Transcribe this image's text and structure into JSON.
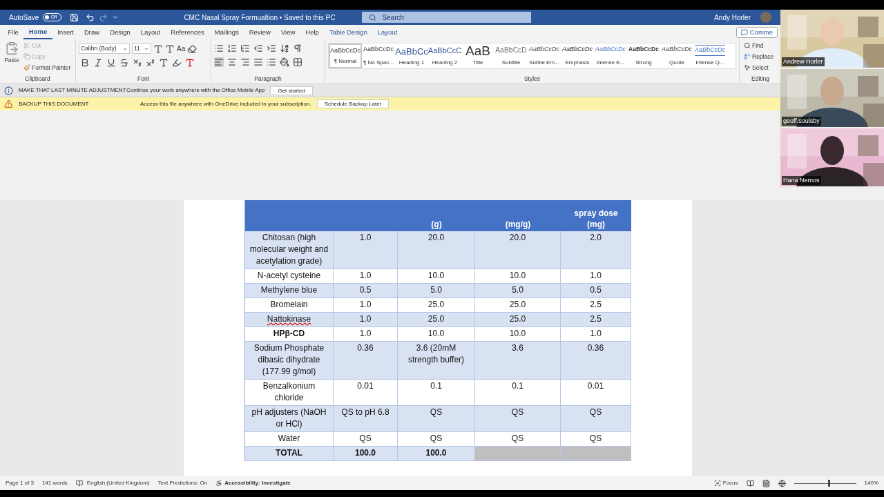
{
  "title_bar": {
    "autosave_label": "AutoSave",
    "autosave": {
      "on": false,
      "label": "Off"
    },
    "title": "CMC Nasal Spray Formualtion • Saved to this PC",
    "search": {
      "placeholder": "Search"
    },
    "user": "Andy Horler"
  },
  "tabs": [
    {
      "label": "File",
      "selected": false,
      "kind": "normal"
    },
    {
      "label": "Home",
      "selected": true,
      "kind": "normal"
    },
    {
      "label": "Insert",
      "selected": false,
      "kind": "normal"
    },
    {
      "label": "Draw",
      "selected": false,
      "kind": "normal"
    },
    {
      "label": "Design",
      "selected": false,
      "kind": "normal"
    },
    {
      "label": "Layout",
      "selected": false,
      "kind": "normal"
    },
    {
      "label": "References",
      "selected": false,
      "kind": "normal"
    },
    {
      "label": "Mailings",
      "selected": false,
      "kind": "normal"
    },
    {
      "label": "Review",
      "selected": false,
      "kind": "normal"
    },
    {
      "label": "View",
      "selected": false,
      "kind": "normal"
    },
    {
      "label": "Help",
      "selected": false,
      "kind": "normal"
    },
    {
      "label": "Table Design",
      "selected": false,
      "kind": "contextual"
    },
    {
      "label": "Layout",
      "selected": false,
      "kind": "contextual"
    }
  ],
  "comments_button": "Comme",
  "clipboard": {
    "paste": "Paste",
    "cut": {
      "label": "Cut",
      "disabled": true
    },
    "copy": {
      "label": "Copy",
      "disabled": true
    },
    "format_painter": "Format Painter",
    "group": "Clipboard"
  },
  "font": {
    "name": "Calibri (Body)",
    "size": "11",
    "case_button": "Aa",
    "group": "Font"
  },
  "paragraph": {
    "group": "Paragraph"
  },
  "styles": {
    "group": "Styles",
    "items": [
      {
        "preview": "AaBbCcDc",
        "label": "¶ Normal",
        "selected": true,
        "kind": "normal"
      },
      {
        "preview": "AaBbCcDc",
        "label": "¶ No Spac...",
        "selected": false,
        "kind": "normal"
      },
      {
        "preview": "AaBbCc",
        "label": "Heading 1",
        "selected": false,
        "kind": "heading1"
      },
      {
        "preview": "AaBbCcC",
        "label": "Heading 2",
        "selected": false,
        "kind": "heading2"
      },
      {
        "preview": "AaB",
        "label": "Title",
        "selected": false,
        "kind": "title"
      },
      {
        "preview": "AaBbCcD",
        "label": "Subtitle",
        "selected": false,
        "kind": "subtitle"
      },
      {
        "preview": "AaBbCcDc",
        "label": "Subtle Em...",
        "selected": false,
        "kind": "italic"
      },
      {
        "preview": "AaBbCcDc",
        "label": "Emphasis",
        "selected": false,
        "kind": "emphasis"
      },
      {
        "preview": "AaBbCcDc",
        "label": "Intense E...",
        "selected": false,
        "kind": "intense"
      },
      {
        "preview": "AaBbCcDc",
        "label": "Strong",
        "selected": false,
        "kind": "strong"
      },
      {
        "preview": "AaBbCcDc",
        "label": "Quote",
        "selected": false,
        "kind": "italic"
      },
      {
        "preview": "AaBbCcDc",
        "label": "Intense Q...",
        "selected": false,
        "kind": "intensequote"
      }
    ]
  },
  "editing": {
    "group": "Editing",
    "find": "Find",
    "replace": "Replace",
    "select": "Select"
  },
  "message_bars": [
    {
      "kind": "info",
      "title": "MAKE THAT LAST MINUTE ADJUSTMENT",
      "text": "Continue your work anywhere with the Office Mobile App",
      "button": "Get started"
    },
    {
      "kind": "warning",
      "title": "BACKUP THIS DOCUMENT",
      "text": "Access this file anywhere with OneDrive included in your subscription.",
      "button": "Schedule Backup Later"
    }
  ],
  "table": {
    "header": [
      "(g)",
      "(mg/g)",
      "spray dose (mg)"
    ],
    "rows": [
      {
        "cells": [
          "Chitosan (high molecular weight and acetylation grade)",
          "1.0",
          "20.0",
          "20.0",
          "2.0"
        ],
        "kind": "normal",
        "misspelled": false
      },
      {
        "cells": [
          "N-acetyl cysteine",
          "1.0",
          "10.0",
          "10.0",
          "1.0"
        ],
        "kind": "normal",
        "misspelled": false
      },
      {
        "cells": [
          "Methylene blue",
          "0.5",
          "5.0",
          "5.0",
          "0.5"
        ],
        "kind": "normal",
        "misspelled": false
      },
      {
        "cells": [
          "Bromelain",
          "1.0",
          "25.0",
          "25.0",
          "2.5"
        ],
        "kind": "normal",
        "misspelled": false
      },
      {
        "cells": [
          "Nattokinase",
          "1.0",
          "25.0",
          "25.0",
          "2.5"
        ],
        "kind": "normal",
        "misspelled": true
      },
      {
        "cells": [
          "HPβ-CD",
          "1.0",
          "10.0",
          "10.0",
          "1.0"
        ],
        "kind": "bold_name",
        "misspelled": false
      },
      {
        "cells": [
          "Sodium Phosphate dibasic dihydrate (177.99 g/mol)",
          "0.36",
          "3.6 (20mM strength buffer)",
          "3.6",
          "0.36"
        ],
        "kind": "normal",
        "misspelled": false
      },
      {
        "cells": [
          "Benzalkonium chloride",
          "0.01",
          "0.1",
          "0.1",
          "0.01"
        ],
        "kind": "normal",
        "misspelled": false
      },
      {
        "cells": [
          "pH adjusters (NaOH or HCl)",
          "QS to pH 6.8",
          "QS",
          "QS",
          "QS"
        ],
        "kind": "normal",
        "misspelled": false
      },
      {
        "cells": [
          "Water",
          "QS",
          "QS",
          "QS",
          "QS"
        ],
        "kind": "normal",
        "misspelled": false
      },
      {
        "cells": [
          "TOTAL",
          "100.0",
          "100.0"
        ],
        "kind": "total",
        "misspelled": false
      }
    ]
  },
  "status_bar": {
    "page": "Page 1 of 3",
    "words": "141 words",
    "language": "English (United Kingdom)",
    "predictions": "Text Predictions: On",
    "accessibility": "Accessibility: Investigate",
    "focus": "Focus",
    "zoom": {
      "level": 0.55
    },
    "zoom_label": "140%"
  },
  "participants": [
    {
      "name": "Andrew Horler"
    },
    {
      "name": "geoff.soulsby"
    },
    {
      "name": "Hana Nemos"
    }
  ]
}
